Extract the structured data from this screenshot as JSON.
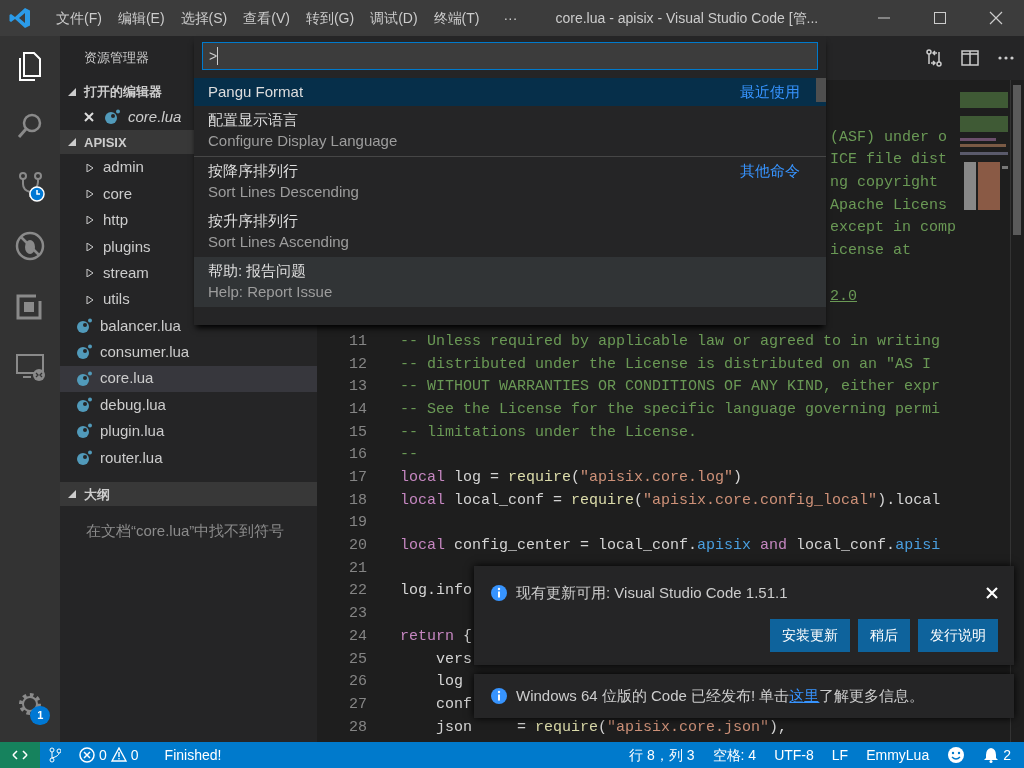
{
  "title_bar": {
    "menus": [
      "文件(F)",
      "编辑(E)",
      "选择(S)",
      "查看(V)",
      "转到(G)",
      "调试(D)",
      "终端(T)"
    ],
    "more": "···",
    "title": "core.lua - apisix - Visual Studio Code [管..."
  },
  "activity_bar": {
    "items": [
      {
        "kind": "files",
        "selected": true
      },
      {
        "kind": "search",
        "selected": false
      },
      {
        "kind": "scm",
        "selected": false
      },
      {
        "kind": "debug",
        "selected": false
      },
      {
        "kind": "extensions",
        "selected": false
      },
      {
        "kind": "remote",
        "selected": false
      }
    ],
    "manage_badge": "1"
  },
  "sidebar": {
    "title": "资源管理器",
    "sections": [
      {
        "title": "打开的编辑器",
        "expanded": true,
        "items": [
          {
            "label": "core.lua",
            "kind": "open-editor",
            "selected": false
          }
        ]
      },
      {
        "title": "APISIX",
        "expanded": true,
        "items": [
          {
            "label": "admin",
            "kind": "folder",
            "expanded": false,
            "selected": false
          },
          {
            "label": "core",
            "kind": "folder",
            "expanded": false,
            "selected": false
          },
          {
            "label": "http",
            "kind": "folder",
            "expanded": false,
            "selected": false
          },
          {
            "label": "plugins",
            "kind": "folder",
            "expanded": false,
            "selected": false
          },
          {
            "label": "stream",
            "kind": "folder",
            "expanded": false,
            "selected": false
          },
          {
            "label": "utils",
            "kind": "folder",
            "expanded": false,
            "selected": false
          },
          {
            "label": "balancer.lua",
            "kind": "file",
            "selected": false
          },
          {
            "label": "consumer.lua",
            "kind": "file",
            "selected": false
          },
          {
            "label": "core.lua",
            "kind": "file",
            "selected": true
          },
          {
            "label": "debug.lua",
            "kind": "file",
            "selected": false
          },
          {
            "label": "plugin.lua",
            "kind": "file",
            "selected": false
          },
          {
            "label": "router.lua",
            "kind": "file",
            "selected": false
          }
        ]
      },
      {
        "title": "大纲",
        "expanded": true,
        "message": "在文档“core.lua”中找不到符号"
      }
    ]
  },
  "editor": {
    "lines": [
      {
        "kind": "covered"
      },
      {
        "kind": "covered",
        "fragment": "(ASF) under o"
      },
      {
        "kind": "covered",
        "fragment": "ICE file dist"
      },
      {
        "kind": "covered",
        "fragment": "ng copyright"
      },
      {
        "kind": "covered",
        "fragment": "Apache Licens"
      },
      {
        "kind": "covered",
        "fragment": "except in comp"
      },
      {
        "kind": "covered",
        "fragment": "icense at"
      },
      {
        "kind": "covered"
      },
      {
        "kind": "covered",
        "fragment": "2.0",
        "link": true
      },
      {
        "kind": "covered"
      },
      {
        "kind": "code",
        "number": "11",
        "tokens": [
          {
            "kind": "comment",
            "text": "-- Unless required by applicable law or agreed to in writing"
          }
        ]
      },
      {
        "kind": "code",
        "number": "12",
        "tokens": [
          {
            "kind": "comment",
            "text": "-- distributed under the License is distributed on an \"AS I"
          }
        ]
      },
      {
        "kind": "code",
        "number": "13",
        "tokens": [
          {
            "kind": "comment",
            "text": "-- WITHOUT WARRANTIES OR CONDITIONS OF ANY KIND, either expr"
          }
        ]
      },
      {
        "kind": "code",
        "number": "14",
        "tokens": [
          {
            "kind": "comment",
            "text": "-- See the License for the specific language governing permi"
          }
        ]
      },
      {
        "kind": "code",
        "number": "15",
        "tokens": [
          {
            "kind": "comment",
            "text": "-- limitations under the License."
          }
        ]
      },
      {
        "kind": "code",
        "number": "16",
        "tokens": [
          {
            "kind": "comment",
            "text": "--"
          }
        ]
      },
      {
        "kind": "code",
        "number": "17",
        "tokens": [
          {
            "kind": "keyword",
            "text": "local"
          },
          {
            "kind": "plain",
            "text": " log = "
          },
          {
            "kind": "function",
            "text": "require"
          },
          {
            "kind": "plain",
            "text": "("
          },
          {
            "kind": "string",
            "text": "\"apisix.core.log\""
          },
          {
            "kind": "plain",
            "text": ")"
          }
        ]
      },
      {
        "kind": "code",
        "number": "18",
        "tokens": [
          {
            "kind": "keyword",
            "text": "local"
          },
          {
            "kind": "plain",
            "text": " local_conf = "
          },
          {
            "kind": "function",
            "text": "require"
          },
          {
            "kind": "plain",
            "text": "("
          },
          {
            "kind": "string",
            "text": "\"apisix.core.config_local\""
          },
          {
            "kind": "plain",
            "text": ").local"
          }
        ]
      },
      {
        "kind": "code",
        "number": "19"
      },
      {
        "kind": "code",
        "number": "20",
        "tokens": [
          {
            "kind": "keyword",
            "text": "local"
          },
          {
            "kind": "plain",
            "text": " config_center = local_conf."
          },
          {
            "kind": "field",
            "text": "apisix"
          },
          {
            "kind": "keyword",
            "text": " and"
          },
          {
            "kind": "plain",
            "text": " local_conf."
          },
          {
            "kind": "field",
            "text": "apisi"
          }
        ]
      },
      {
        "kind": "code",
        "number": "21"
      },
      {
        "kind": "code",
        "number": "22",
        "tokens": [
          {
            "kind": "plain",
            "text": "log.info"
          }
        ]
      },
      {
        "kind": "code",
        "number": "23"
      },
      {
        "kind": "code",
        "number": "24",
        "tokens": [
          {
            "kind": "keyword",
            "text": "return"
          },
          {
            "kind": "plain",
            "text": " {"
          }
        ]
      },
      {
        "kind": "code",
        "number": "25",
        "tokens": [
          {
            "kind": "plain",
            "text": "    vers"
          }
        ]
      },
      {
        "kind": "code",
        "number": "26",
        "tokens": [
          {
            "kind": "plain",
            "text": "    log"
          }
        ]
      },
      {
        "kind": "code",
        "number": "27",
        "tokens": [
          {
            "kind": "plain",
            "text": "    conf"
          }
        ]
      },
      {
        "kind": "code",
        "number": "28",
        "tokens": [
          {
            "kind": "plain",
            "text": "    json     = "
          },
          {
            "kind": "function",
            "text": "require"
          },
          {
            "kind": "plain",
            "text": "("
          },
          {
            "kind": "string",
            "text": "\"apisix.core.json\""
          },
          {
            "kind": "plain",
            "text": "),"
          }
        ]
      }
    ]
  },
  "command_palette": {
    "value": ">",
    "items": [
      {
        "label": "Pangu Format",
        "tag": "最近使用",
        "selected": true,
        "hovered": false
      },
      {
        "label": "配置显示语言",
        "detail": "Configure Display Language",
        "selected": false,
        "hovered": false
      },
      {
        "label": "按降序排列行",
        "detail": "Sort Lines Descending",
        "tag": "其他命令",
        "separator": true,
        "selected": false,
        "hovered": false
      },
      {
        "label": "按升序排列行",
        "detail": "Sort Lines Ascending",
        "selected": false,
        "hovered": false
      },
      {
        "label": "帮助: 报告问题",
        "detail": "Help: Report Issue",
        "selected": false,
        "hovered": true
      }
    ]
  },
  "notifications": [
    {
      "kind": "update",
      "message": "现有更新可用: Visual Studio Code 1.51.1",
      "buttons": [
        "安装更新",
        "稍后",
        "发行说明"
      ]
    },
    {
      "kind": "link",
      "text_before": "Windows 64 位版的 Code 已经发布! 单击",
      "link": "这里",
      "text_after": "了解更多信息。"
    }
  ],
  "status_bar": {
    "errors": "0",
    "warnings": "0",
    "message": "Finished!",
    "items": [
      "行 8，列 3",
      "空格: 4",
      "UTF-8",
      "LF",
      "EmmyLua"
    ],
    "notification_count": "2"
  }
}
